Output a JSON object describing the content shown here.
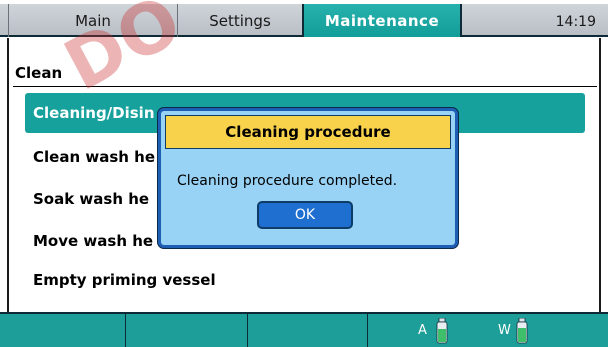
{
  "tabs": [
    {
      "label": "Main"
    },
    {
      "label": "Settings"
    },
    {
      "label": "Maintenance"
    }
  ],
  "clock": "14:19",
  "section": {
    "title": "Clean"
  },
  "menu": {
    "items": [
      {
        "label": "Cleaning/Disin"
      },
      {
        "label": "Clean wash he"
      },
      {
        "label": "Soak wash he"
      },
      {
        "label": "Move wash he"
      },
      {
        "label": "Empty priming vessel"
      }
    ]
  },
  "dialog": {
    "title": "Cleaning procedure",
    "message": "Cleaning procedure completed.",
    "ok_label": "OK"
  },
  "status": {
    "a_label": "A",
    "w_label": "W"
  },
  "watermark": "DO",
  "colors": {
    "accent": "#16a19c",
    "dialog_bg": "#98d2f5",
    "dialog_title": "#f7d24a",
    "ok_button": "#1f6fd1"
  }
}
